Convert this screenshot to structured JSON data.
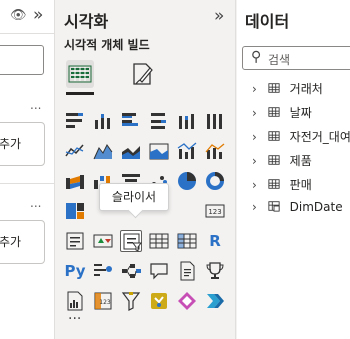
{
  "left_pane": {
    "more1": "...",
    "card1_label": "추가",
    "more2": "...",
    "card2_label": "추가"
  },
  "viz_pane": {
    "title": "시각화",
    "collapse": "»",
    "subtitle": "시각적 개체 빌드",
    "tooltip": "슬라이서",
    "more": "...",
    "text_icons": {
      "r": "R",
      "py": "Py",
      "kpi_123": "123"
    }
  },
  "data_pane": {
    "title": "데이터",
    "search_placeholder": "검색",
    "tables": [
      {
        "name": "거래처"
      },
      {
        "name": "날짜"
      },
      {
        "name": "자전거_대여"
      },
      {
        "name": "제품"
      },
      {
        "name": "판매"
      },
      {
        "name": "DimDate"
      }
    ]
  },
  "colors": {
    "accent_blue": "#2b72c7",
    "orange": "#e07b00",
    "gold": "#c9a200",
    "teal": "#2a9fd0"
  }
}
